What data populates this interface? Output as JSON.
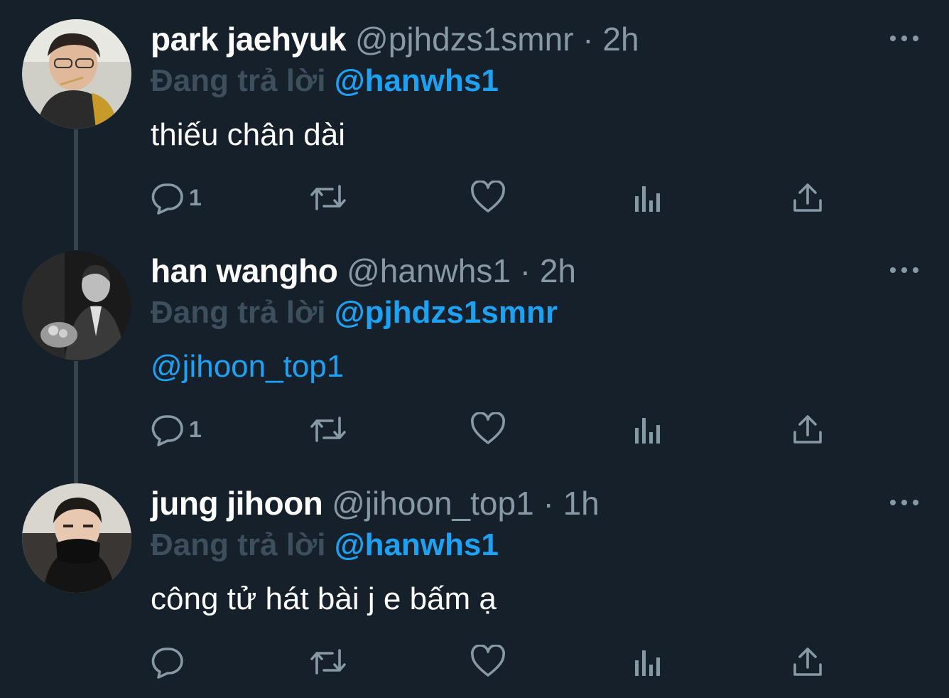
{
  "tweets": [
    {
      "name": "park jaehyuk",
      "handle": "@pjhdzs1smnr",
      "separator": "·",
      "time": "2h",
      "reply_label": "Đang trả lời",
      "reply_to": "@hanwhs1",
      "text": "thiếu chân dài",
      "reply_count": "1",
      "avatar_icon": "user-photo"
    },
    {
      "name": "han wangho",
      "handle": "@hanwhs1",
      "separator": "·",
      "time": "2h",
      "reply_label": "Đang trả lời",
      "reply_to": "@pjhdzs1smnr",
      "text": "@jihoon_top1",
      "reply_count": "1",
      "avatar_icon": "user-photo"
    },
    {
      "name": "jung jihoon",
      "handle": "@jihoon_top1",
      "separator": "·",
      "time": "1h",
      "reply_label": "Đang trả lời",
      "reply_to": "@hanwhs1",
      "text": "công tử hát bài j e bấm ạ",
      "reply_count": "",
      "avatar_icon": "user-photo"
    }
  ],
  "icons": {
    "reply": "reply-icon",
    "retweet": "retweet-icon",
    "like": "heart-icon",
    "analytics": "analytics-icon",
    "share": "share-icon",
    "more": "more-icon"
  },
  "colors": {
    "background": "#15202b",
    "secondary_text": "#8899a6",
    "mention": "#1da1f2",
    "reply_label": "#3d4e5c",
    "thread_line": "#38444d"
  }
}
